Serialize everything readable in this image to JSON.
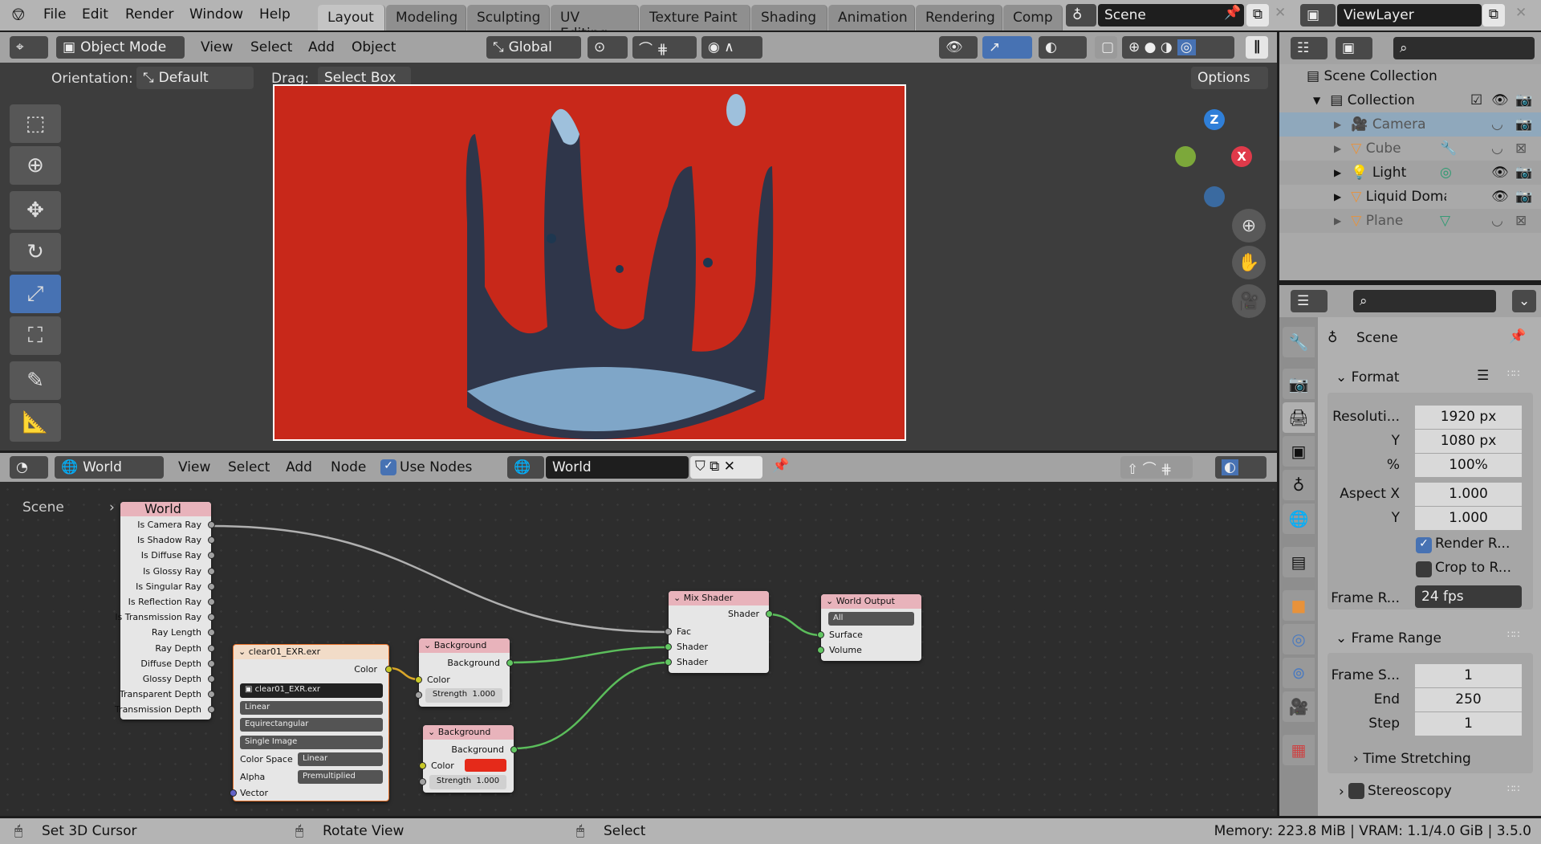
{
  "topbar": {
    "menus": [
      "File",
      "Edit",
      "Render",
      "Window",
      "Help"
    ],
    "workspaces": [
      "Layout",
      "Modeling",
      "Sculpting",
      "UV Editing",
      "Texture Paint",
      "Shading",
      "Animation",
      "Rendering",
      "Comp"
    ],
    "active_workspace": "Layout",
    "scene": "Scene",
    "view_layer": "ViewLayer"
  },
  "viewport": {
    "mode": "Object Mode",
    "menus": [
      "View",
      "Select",
      "Add",
      "Object"
    ],
    "transform_orientation": "Global",
    "orientation_label": "Orientation:",
    "orientation_value": "Default",
    "drag_label": "Drag:",
    "drag_value": "Select Box",
    "options": "Options",
    "gizmo": {
      "z": "Z",
      "x": "X"
    },
    "background_color": "#c8281a"
  },
  "node_editor": {
    "type": "World",
    "menus": [
      "View",
      "Select",
      "Add",
      "Node"
    ],
    "use_nodes_label": "Use Nodes",
    "use_nodes": true,
    "world_name": "World",
    "breadcrumb": [
      "Scene",
      "World"
    ],
    "light_path": {
      "title": "World",
      "outputs": [
        "Is Camera Ray",
        "Is Shadow Ray",
        "Is Diffuse Ray",
        "Is Glossy Ray",
        "Is Singular Ray",
        "Is Reflection Ray",
        "Is Transmission Ray",
        "Ray Length",
        "Ray Depth",
        "Diffuse Depth",
        "Glossy Depth",
        "Transparent Depth",
        "Transmission Depth"
      ]
    },
    "image": {
      "title": "clear01_EXR.exr",
      "output": "Color",
      "image_name": "clear01_EXR.exr",
      "interpolation": "Linear",
      "projection": "Equirectangular",
      "source": "Single Image",
      "color_space_label": "Color Space",
      "color_space": "Linear",
      "alpha_label": "Alpha",
      "alpha": "Premultiplied",
      "input": "Vector"
    },
    "background1": {
      "title": "Background",
      "output": "Background",
      "color_label": "Color",
      "strength_label": "Strength",
      "strength": "1.000"
    },
    "background2": {
      "title": "Background",
      "output": "Background",
      "color_label": "Color",
      "color": "#e52a1a",
      "strength_label": "Strength",
      "strength": "1.000"
    },
    "mix": {
      "title": "Mix Shader",
      "output": "Shader",
      "inputs": [
        "Fac",
        "Shader",
        "Shader"
      ]
    },
    "output": {
      "title": "World Output",
      "target": "All",
      "inputs": [
        "Surface",
        "Volume"
      ]
    }
  },
  "outliner": {
    "root": "Scene Collection",
    "collection": "Collection",
    "items": [
      {
        "name": "Camera",
        "selected": true
      },
      {
        "name": "Cube"
      },
      {
        "name": "Light"
      },
      {
        "name": "Liquid Doma"
      },
      {
        "name": "Plane"
      }
    ]
  },
  "properties": {
    "context": "Scene",
    "format": {
      "title": "Format",
      "rows": [
        {
          "label": "Resoluti...",
          "value": "1920 px"
        },
        {
          "label": "Y",
          "value": "1080 px"
        },
        {
          "label": "%",
          "value": "100%"
        },
        {
          "label": "Aspect X",
          "value": "1.000"
        },
        {
          "label": "Y",
          "value": "1.000"
        }
      ],
      "render_region": "Render R...",
      "render_region_checked": true,
      "crop": "Crop to R...",
      "crop_checked": false,
      "frame_rate_label": "Frame R...",
      "frame_rate": "24 fps"
    },
    "frame_range": {
      "title": "Frame Range",
      "rows": [
        {
          "label": "Frame S...",
          "value": "1"
        },
        {
          "label": "End",
          "value": "250"
        },
        {
          "label": "Step",
          "value": "1"
        }
      ],
      "time_stretching": "Time Stretching"
    },
    "stereoscopy": "Stereoscopy"
  },
  "status": {
    "left": "Set 3D Cursor",
    "middle": "Rotate View",
    "right": "Select",
    "info": "Memory: 223.8 MiB | VRAM: 1.1/4.0 GiB | 3.5.0"
  }
}
